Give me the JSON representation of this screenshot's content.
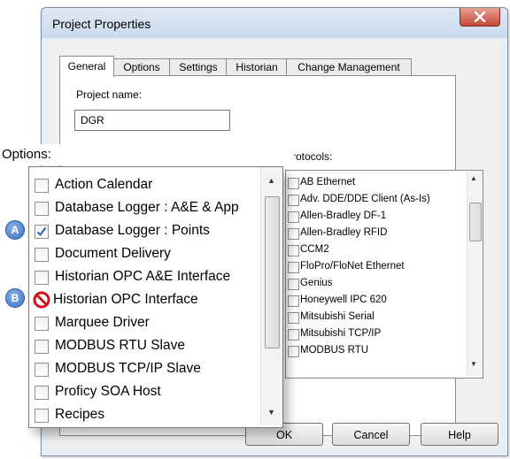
{
  "dialog": {
    "title": "Project Properties",
    "close_icon": "close-x-icon"
  },
  "tabs": [
    {
      "label": "General",
      "active": true
    },
    {
      "label": "Options",
      "active": false
    },
    {
      "label": "Settings",
      "active": false
    },
    {
      "label": "Historian",
      "active": false
    },
    {
      "label": "Change Management",
      "active": false
    }
  ],
  "project": {
    "name_label": "Project name:",
    "name_value": "DGR"
  },
  "protocols": {
    "label": "rotocols:",
    "items": [
      "AB Ethernet",
      "Adv. DDE/DDE Client (As-Is)",
      "Allen-Bradley DF-1",
      "Allen-Bradley RFID",
      "CCM2",
      "FloPro/FloNet Ethernet",
      "Genius",
      "Honeywell IPC 620",
      "Mitsubishi Serial",
      "Mitsubishi TCP/IP",
      "MODBUS RTU"
    ]
  },
  "options": {
    "label": "Options:",
    "items": [
      {
        "label": "Action Calendar",
        "state": "unchecked"
      },
      {
        "label": "Database Logger : A&E & App",
        "state": "unchecked"
      },
      {
        "label": "Database Logger : Points",
        "state": "checked"
      },
      {
        "label": "Document Delivery",
        "state": "unchecked"
      },
      {
        "label": "Historian OPC A&E Interface",
        "state": "unchecked"
      },
      {
        "label": "Historian OPC Interface",
        "state": "prohibited"
      },
      {
        "label": "Marquee Driver",
        "state": "unchecked"
      },
      {
        "label": "MODBUS RTU Slave",
        "state": "unchecked"
      },
      {
        "label": "MODBUS TCP/IP Slave",
        "state": "unchecked"
      },
      {
        "label": "Proficy SOA Host",
        "state": "unchecked"
      },
      {
        "label": "Recipes",
        "state": "unchecked"
      }
    ]
  },
  "markers": {
    "a": "A",
    "b": "B"
  },
  "buttons": {
    "ok": "OK",
    "cancel": "Cancel",
    "help": "Help"
  }
}
